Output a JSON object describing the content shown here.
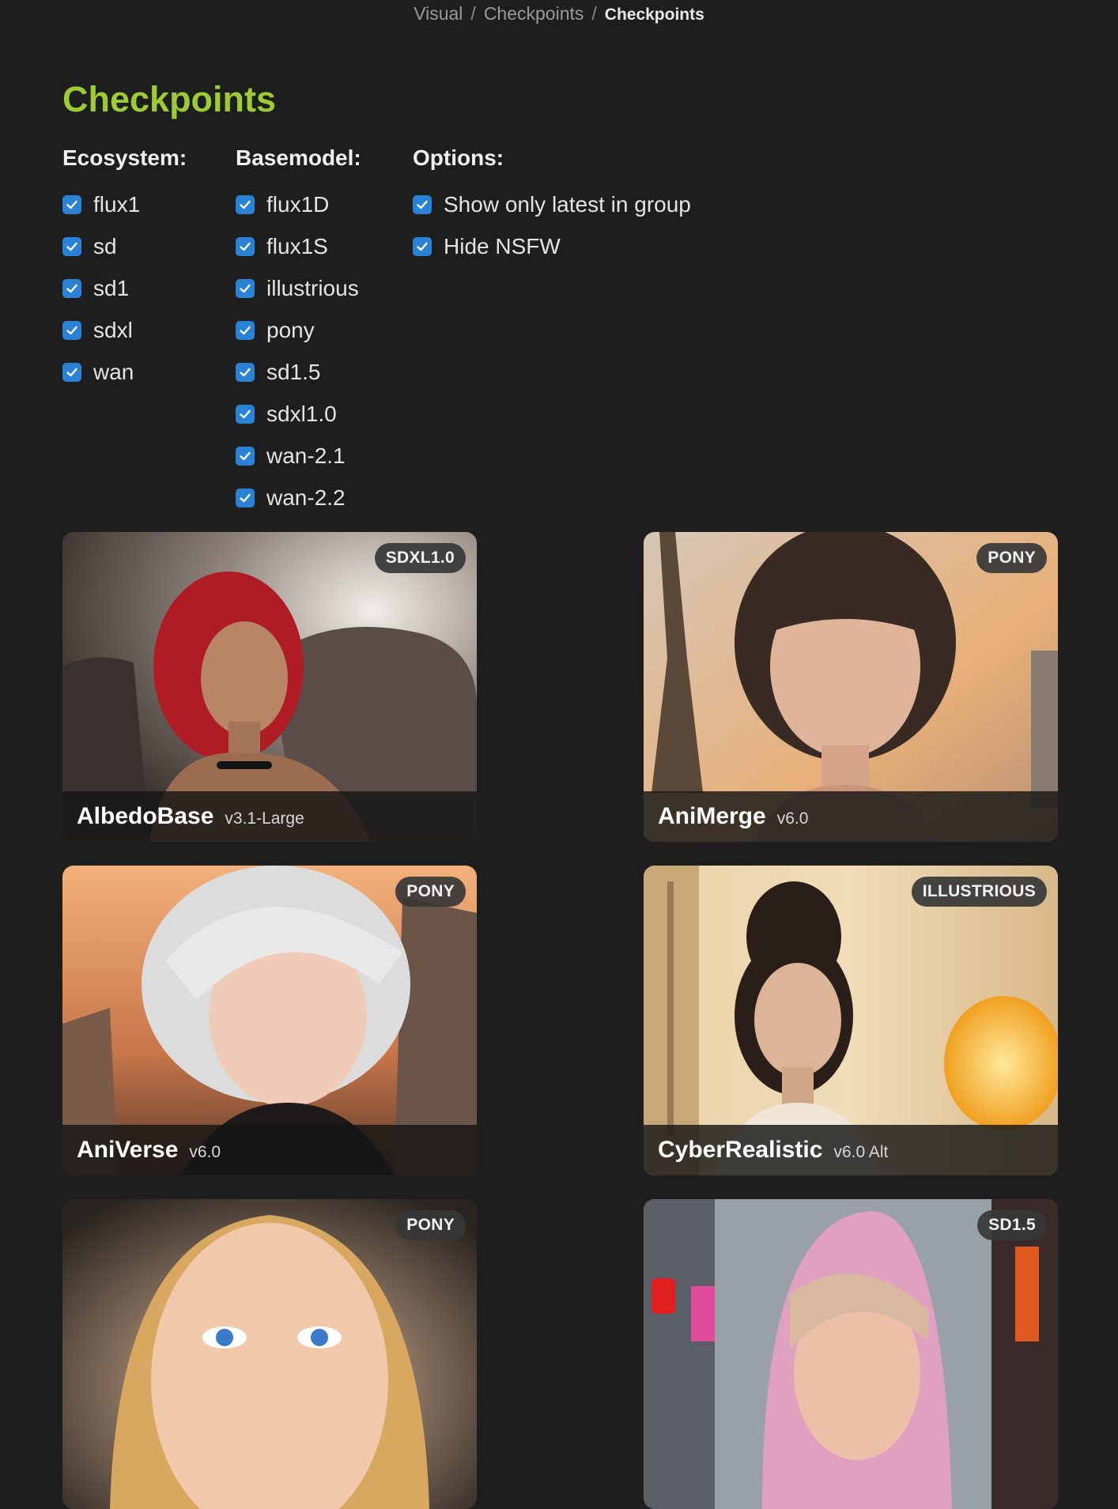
{
  "breadcrumb": {
    "items": [
      "Visual",
      "Checkpoints"
    ],
    "separator": "/",
    "current": "Checkpoints"
  },
  "page_title": "Checkpoints",
  "colors": {
    "background": "#1e1e1e",
    "title_accent": "#9ccb33",
    "checkbox": "#2a82d6"
  },
  "filters": {
    "ecosystem": {
      "heading": "Ecosystem:",
      "options": [
        {
          "label": "flux1",
          "checked": true
        },
        {
          "label": "sd",
          "checked": true
        },
        {
          "label": "sd1",
          "checked": true
        },
        {
          "label": "sdxl",
          "checked": true
        },
        {
          "label": "wan",
          "checked": true
        }
      ]
    },
    "basemodel": {
      "heading": "Basemodel:",
      "options": [
        {
          "label": "flux1D",
          "checked": true
        },
        {
          "label": "flux1S",
          "checked": true
        },
        {
          "label": "illustrious",
          "checked": true
        },
        {
          "label": "pony",
          "checked": true
        },
        {
          "label": "sd1.5",
          "checked": true
        },
        {
          "label": "sdxl1.0",
          "checked": true
        },
        {
          "label": "wan-2.1",
          "checked": true
        },
        {
          "label": "wan-2.2",
          "checked": true
        }
      ]
    },
    "options": {
      "heading": "Options:",
      "options": [
        {
          "label": "Show only latest in group",
          "checked": true
        },
        {
          "label": "Hide NSFW",
          "checked": true
        }
      ]
    }
  },
  "cards": [
    {
      "name": "AlbedoBase",
      "version": "v3.1-Large",
      "badge": "SDXL1.0"
    },
    {
      "name": "AniMerge",
      "version": "v6.0",
      "badge": "PONY"
    },
    {
      "name": "AniVerse",
      "version": "v6.0",
      "badge": "PONY"
    },
    {
      "name": "CyberRealistic",
      "version": "v6.0 Alt",
      "badge": "ILLUSTRIOUS"
    },
    {
      "name": "",
      "version": "",
      "badge": "PONY"
    },
    {
      "name": "",
      "version": "",
      "badge": "SD1.5"
    }
  ]
}
